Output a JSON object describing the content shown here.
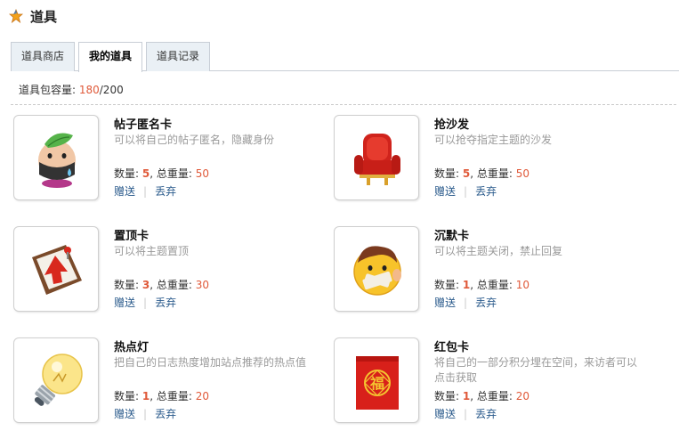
{
  "header": {
    "title": "道具",
    "icon": "star-icon"
  },
  "tabs": [
    {
      "label": "道具商店",
      "active": false
    },
    {
      "label": "我的道具",
      "active": true
    },
    {
      "label": "道具记录",
      "active": false
    }
  ],
  "capacity": {
    "label": "道具包容量: ",
    "used": "180",
    "total": "/200"
  },
  "stat_labels": {
    "count": "数量: ",
    "weight": ", 总重量: "
  },
  "items": [
    {
      "name": "帖子匿名卡",
      "desc": "可以将自己的帖子匿名，隐藏身份",
      "count": "5",
      "weight": "50",
      "give": "赠送",
      "discard": "丢弃",
      "icon": "masked-man-icon"
    },
    {
      "name": "抢沙发",
      "desc": "可以抢夺指定主题的沙发",
      "count": "5",
      "weight": "50",
      "give": "赠送",
      "discard": "丢弃",
      "icon": "sofa-icon"
    },
    {
      "name": "置顶卡",
      "desc": "可以将主题置顶",
      "count": "3",
      "weight": "30",
      "give": "赠送",
      "discard": "丢弃",
      "icon": "pin-top-icon"
    },
    {
      "name": "沉默卡",
      "desc": "可以将主题关闭，禁止回复",
      "count": "1",
      "weight": "10",
      "give": "赠送",
      "discard": "丢弃",
      "icon": "silenced-face-icon"
    },
    {
      "name": "热点灯",
      "desc": "把自己的日志热度增加站点推荐的热点值",
      "count": "1",
      "weight": "20",
      "give": "赠送",
      "discard": "丢弃",
      "icon": "light-bulb-icon"
    },
    {
      "name": "红包卡",
      "desc": "将自己的一部分积分埋在空间，来访者可以点击获取",
      "count": "1",
      "weight": "20",
      "give": "赠送",
      "discard": "丢弃",
      "icon": "red-envelope-icon"
    }
  ]
}
